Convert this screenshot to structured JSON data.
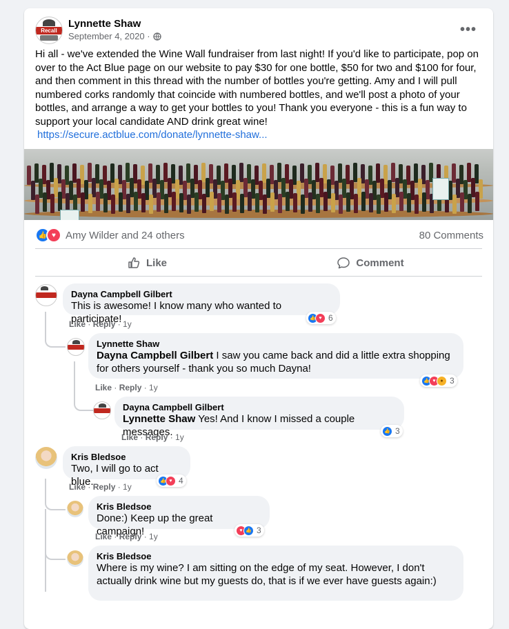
{
  "post": {
    "author": "Lynnette Shaw",
    "date": "September 4, 2020 ·",
    "audience_icon": "public-globe-icon",
    "more_icon": "•••",
    "text": "Hi all - we've extended the Wine Wall fundraiser from last night! If you'd like to participate, pop on over to the Act Blue page on our website to pay $30 for one bottle, $50 for two and $100 for four, and then comment in this thread with the number of bottles you're getting. Amy and I will pull numbered corks randomly that coincide with numbered bottles, and we'll post a photo of your bottles, and arrange a way to get your bottles to you! Thank you everyone - this is a fun way to support your local candidate AND drink great wine!",
    "link": "https://secure.actblue.com/donate/lynnette-shaw...",
    "reactions_text": "Amy Wilder and 24 others",
    "comments_count": "80 Comments",
    "like_label": "Like",
    "comment_label": "Comment"
  },
  "comments": [
    {
      "author": "Dayna Campbell Gilbert",
      "text": "This is awesome! I know many who wanted to participate!",
      "like": "Like",
      "reply": "Reply",
      "time": "1y",
      "reaction_count": "6"
    },
    {
      "author": "Lynnette Shaw",
      "mention": "Dayna Campbell Gilbert",
      "text": " I saw you came back and did a little extra shopping for others yourself - thank you so much Dayna!",
      "like": "Like",
      "reply": "Reply",
      "time": "1y",
      "reaction_count": "3"
    },
    {
      "author": "Dayna Campbell Gilbert",
      "mention": "Lynnette Shaw",
      "text": " Yes! And I know I missed a couple messages.",
      "like": "Like",
      "reply": "Reply",
      "time": "1y",
      "reaction_count": "3"
    },
    {
      "author": "Kris Bledsoe",
      "text": "Two, I will go to act blue.",
      "like": "Like",
      "reply": "Reply",
      "time": "1y",
      "reaction_count": "4"
    },
    {
      "author": "Kris Bledsoe",
      "text": "Done:) Keep up the great campaign!",
      "like": "Like",
      "reply": "Reply",
      "time": "1y",
      "reaction_count": "3"
    },
    {
      "author": "Kris Bledsoe",
      "text": "Where is my wine? I am sitting on the edge of my seat. However, I don't actually drink wine but my guests do, that is if we ever have guests again:)"
    }
  ],
  "logo_text": "Recall",
  "colors": {
    "accent": "#1877f2",
    "love": "#f33e58",
    "link": "#216fdb",
    "muted": "#65676b"
  }
}
